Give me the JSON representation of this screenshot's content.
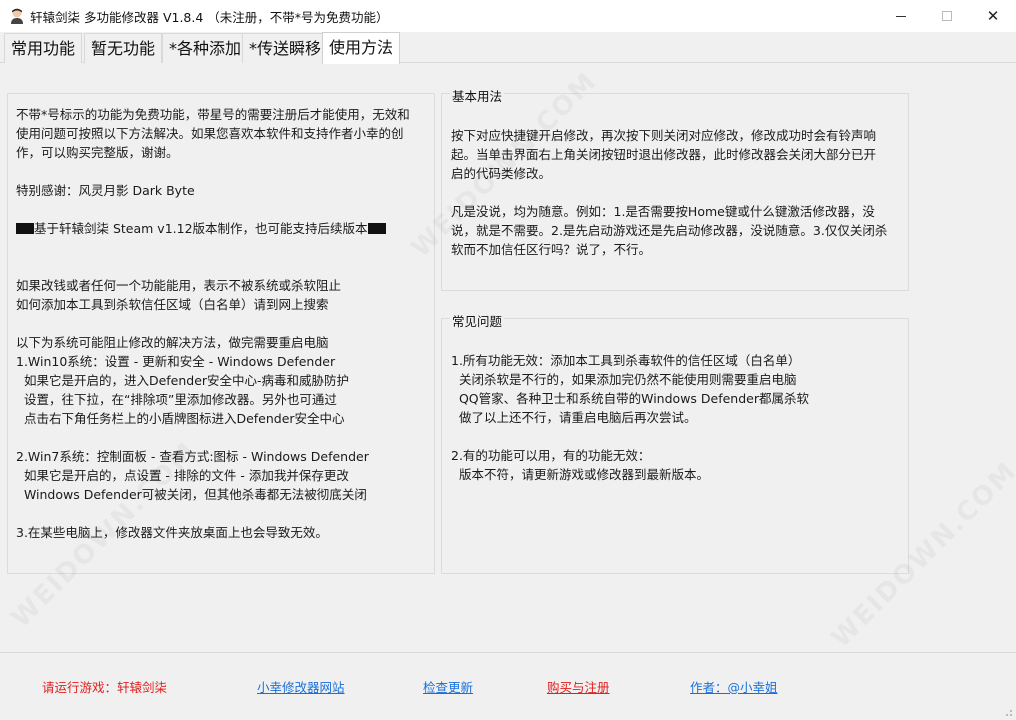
{
  "window": {
    "title": "轩辕剑柒 多功能修改器  V1.8.4  （未注册，不带*号为免费功能）",
    "icon": "avatar-icon",
    "minimize_icon": "minimize-icon",
    "maximize_icon": "maximize-icon",
    "close_icon": "close-icon",
    "close_glyph": "✕"
  },
  "tabs": [
    {
      "label": "常用功能"
    },
    {
      "label": "暂无功能"
    },
    {
      "label": "*各种添加"
    },
    {
      "label": "*传送瞬移"
    },
    {
      "label": "使用方法",
      "active": true
    }
  ],
  "left_panel": {
    "lines": [
      "不带*号标示的功能为免费功能，带星号的需要注册后才能使用，无效和",
      "使用问题可按照以下方法解决。如果您喜欢本软件和支持作者小幸的创",
      "作，可以购买完整版，谢谢。",
      "",
      "特别感谢：风灵月影 Dark Byte",
      "",
      "基于轩辕剑柒 Steam v1.12版本制作，也可能支持后续版本",
      "",
      "",
      "如果改钱或者任何一个功能能用，表示不被系统或杀软阻止",
      "如何添加本工具到杀软信任区域（白名单）请到网上搜索",
      "",
      "以下为系统可能阻止修改的解决方法，做完需要重启电脑",
      "1.Win10系统：设置 - 更新和安全 - Windows Defender",
      "  如果它是开启的，进入Defender安全中心-病毒和威胁防护",
      "  设置，往下拉，在“排除项”里添加修改器。另外也可通过",
      "  点击右下角任务栏上的小盾牌图标进入Defender安全中心",
      "",
      "2.Win7系统：控制面板 - 查看方式:图标 - Windows Defender",
      "  如果它是开启的，点设置 - 排除的文件 - 添加我并保存更改",
      "  Windows Defender可被关闭，但其他杀毒都无法被彻底关闭",
      "",
      "3.在某些电脑上，修改器文件夹放桌面上也会导致无效。"
    ]
  },
  "basic_usage": {
    "title": "基本用法",
    "lines": [
      "按下对应快捷键开启修改，再次按下则关闭对应修改，修改成功时会有铃声响",
      "起。当单击界面右上角关闭按钮时退出修改器，此时修改器会关闭大部分已开",
      "启的代码类修改。",
      "",
      "凡是没说，均为随意。例如：1.是否需要按Home键或什么键激活修改器，没",
      "说，就是不需要。2.是先启动游戏还是先启动修改器，没说随意。3.仅仅关闭杀",
      "软而不加信任区行吗？说了，不行。"
    ]
  },
  "faq": {
    "title": "常见问题",
    "lines": [
      "1.所有功能无效：添加本工具到杀毒软件的信任区域（白名单）",
      "  关闭杀软是不行的，如果添加完仍然不能使用则需要重启电脑",
      "  QQ管家、各种卫士和系统自带的Windows Defender都属杀软",
      "  做了以上还不行，请重启电脑后再次尝试。",
      "",
      "2.有的功能可以用，有的功能无效：",
      "  版本不符，请更新游戏或修改器到最新版本。"
    ]
  },
  "footer": {
    "run_game": "请运行游戏：轩辕剑柒",
    "website": "小幸修改器网站",
    "check_update": "检查更新",
    "buy_register": "购买与注册",
    "author": "作者：@小幸姐"
  },
  "watermark": "WEIDOWN.COM",
  "colors": {
    "red": "#e02020",
    "link_blue": "#1a6fd8",
    "background": "#f0f0f0"
  }
}
